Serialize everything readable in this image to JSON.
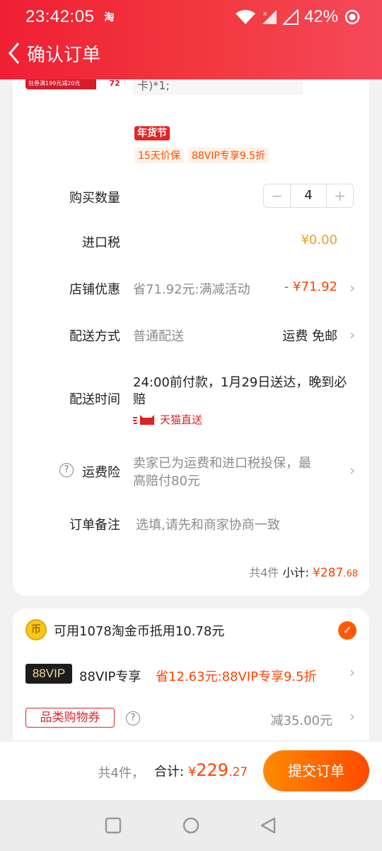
{
  "status_bar": {
    "time": "23:42:05",
    "app_badge": "淘",
    "battery": "42%"
  },
  "nav": {
    "title": "确认订单"
  },
  "product": {
    "thumb_text": "狂券满199元减20元",
    "thumb_number": "72",
    "spec_text": "卡)*1;",
    "festival_tag": "年货节",
    "tags": [
      "15天价保",
      "88VIP专享9.5折"
    ]
  },
  "quantity": {
    "label": "购买数量",
    "value": "4",
    "minus": "−",
    "plus": "+"
  },
  "import_tax": {
    "label": "进口税",
    "value": "¥0.00"
  },
  "shop_discount": {
    "label": "店铺优惠",
    "desc": "省71.92元:满减活动",
    "value": "- ¥71.92"
  },
  "delivery_method": {
    "label": "配送方式",
    "value": "普通配送",
    "fee": "运费 免邮"
  },
  "delivery_time": {
    "label": "配送时间",
    "line1": "24:00前付款，1月29日送达，晚到必",
    "line2": "赔",
    "service": "天猫直送"
  },
  "freight_insurance": {
    "label": "运费险",
    "line1": "卖家已为运费和进口税投保，最",
    "line2": "高赔付80元"
  },
  "order_note": {
    "label": "订单备注",
    "placeholder": "选填,请先和商家协商一致"
  },
  "subtotal": {
    "count": "共4件",
    "label": "小计:",
    "currency": "¥",
    "amount": "287",
    "cents": ".68"
  },
  "benefits": {
    "coin_icon_text": "币",
    "coin_text": "可用1078淘金币抵用10.78元",
    "vip_badge": "88VIP",
    "vip_label": "88VIP专享",
    "vip_value": "省12.63元:88VIP专享9.5折",
    "coupon_label": "品类购物券",
    "coupon_value": "减35.00元"
  },
  "bottom_bar": {
    "count": "共4件，",
    "total_label": "合计:",
    "currency": "¥",
    "amount": "229",
    "cents": ".27",
    "submit": "提交订单"
  },
  "colors": {
    "brand_red": "#f2393f",
    "price_orange": "#ff4400",
    "tax_gold": "#f0a020",
    "submit_orange": "#ff6a00"
  }
}
